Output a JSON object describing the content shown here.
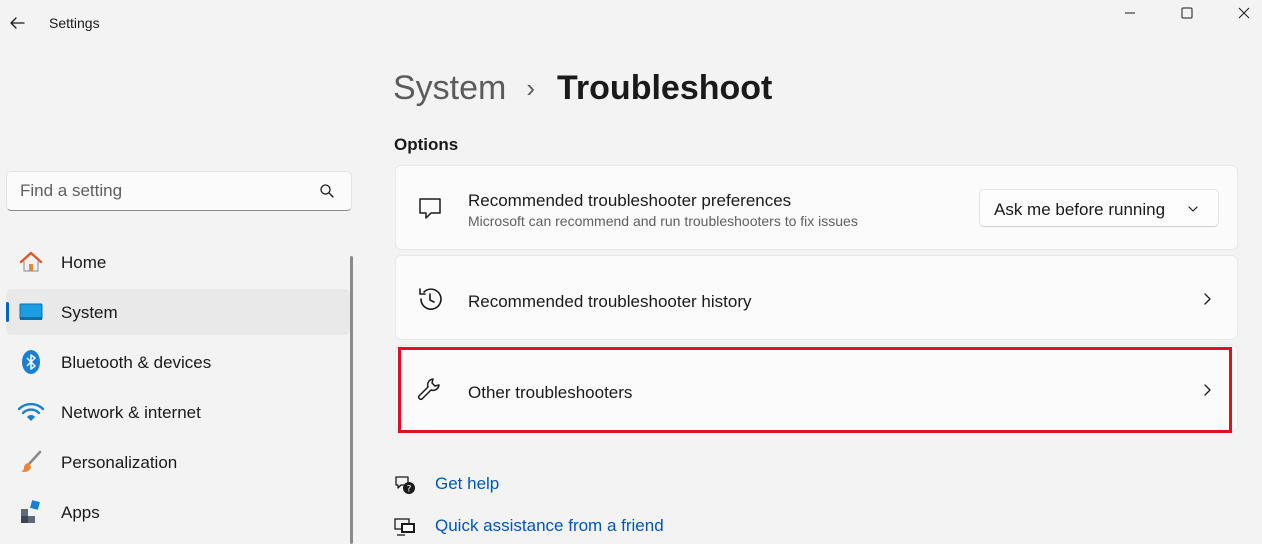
{
  "window": {
    "title": "Settings",
    "controls": [
      "minimize",
      "maximize",
      "close"
    ]
  },
  "search": {
    "placeholder": "Find a setting",
    "value": ""
  },
  "sidebar": {
    "items": [
      {
        "label": "Home",
        "icon": "home-icon",
        "active": false
      },
      {
        "label": "System",
        "icon": "monitor-icon",
        "active": true
      },
      {
        "label": "Bluetooth & devices",
        "icon": "bluetooth-icon",
        "active": false
      },
      {
        "label": "Network & internet",
        "icon": "wifi-icon",
        "active": false
      },
      {
        "label": "Personalization",
        "icon": "brush-icon",
        "active": false
      },
      {
        "label": "Apps",
        "icon": "apps-icon",
        "active": false
      }
    ]
  },
  "breadcrumb": {
    "parent": "System",
    "separator": "›",
    "current": "Troubleshoot"
  },
  "section": {
    "title": "Options"
  },
  "cards": [
    {
      "title": "Recommended troubleshooter preferences",
      "subtitle": "Microsoft can recommend and run troubleshooters to fix issues",
      "icon": "message-icon",
      "dropdown_value": "Ask me before running"
    },
    {
      "title": "Recommended troubleshooter history",
      "icon": "history-icon"
    },
    {
      "title": "Other troubleshooters",
      "icon": "wrench-icon",
      "highlighted": true
    }
  ],
  "links": [
    {
      "label": "Get help",
      "icon": "help-chat-icon"
    },
    {
      "label": "Quick assistance from a friend",
      "icon": "remote-assist-icon"
    }
  ],
  "colors": {
    "accent": "#0067c0",
    "link": "#0057b8",
    "highlight": "#e0101e",
    "background": "#f3f3f3",
    "card": "#fbfbfb"
  }
}
